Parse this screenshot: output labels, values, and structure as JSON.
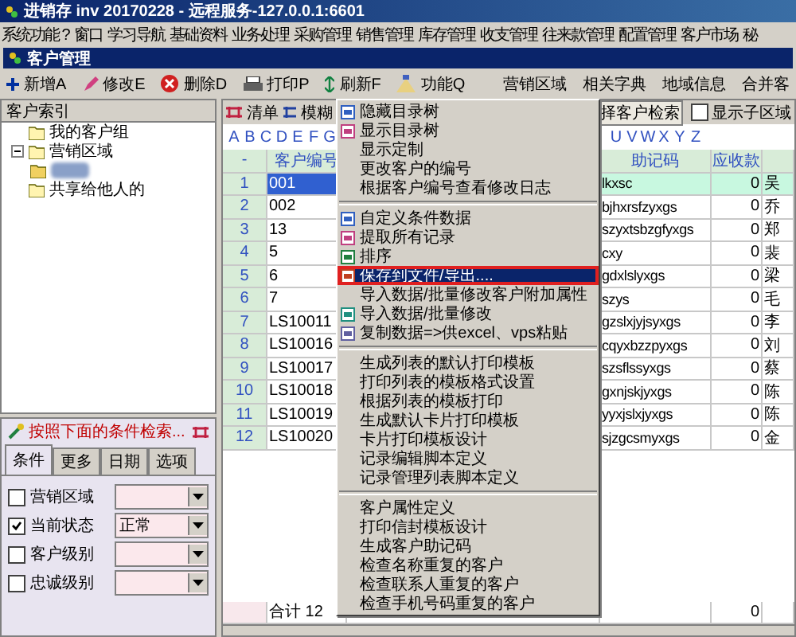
{
  "title": "进销存 inv 20170228 - 远程服务-127.0.0.1:6601",
  "menubar": [
    "系统功能 ?",
    "窗口",
    "学习导航",
    "基础资料",
    "业务处理",
    "采购管理",
    "销售管理",
    "库存管理",
    "收支管理",
    "往来款管理",
    "配置管理",
    "客户市场",
    "秘"
  ],
  "window_title": "客户管理",
  "toolbar": [
    {
      "label": "新增A",
      "kind": "add"
    },
    {
      "label": "修改E",
      "kind": "edit"
    },
    {
      "label": "删除D",
      "kind": "delete"
    },
    {
      "label": "打印P",
      "kind": "print"
    },
    {
      "label": "刷新F",
      "kind": "refresh"
    },
    {
      "label": "功能Q",
      "kind": "function"
    }
  ],
  "toolbar_links": [
    "营销区域",
    "相关字典",
    "地域信息",
    "合并客"
  ],
  "index_panel": {
    "title": "客户索引",
    "tree": [
      {
        "label": "我的客户组",
        "expanded": false
      },
      {
        "label": "营销区域",
        "expanded": true,
        "children": [
          {
            "kind": "blurred"
          }
        ]
      },
      {
        "label": "共享给他人的",
        "expanded": false
      }
    ]
  },
  "search_panel": {
    "title": "按照下面的条件检索...",
    "tabs": [
      {
        "label": "条件",
        "selected": true
      },
      {
        "label": "更多",
        "selected": false
      },
      {
        "label": "日期",
        "selected": false
      },
      {
        "label": "选项",
        "selected": false
      }
    ],
    "conditions": [
      {
        "label": "营销区域",
        "checked": false
      },
      {
        "label": "当前状态",
        "checked": true,
        "value": "正常"
      },
      {
        "label": "客户级别",
        "checked": false
      },
      {
        "label": "忠诚级别",
        "checked": false
      }
    ]
  },
  "grid": {
    "toolbar": [
      "清单",
      "模糊"
    ],
    "search_button": "择客户检索",
    "subregion_checkbox": {
      "label": "显示子区域",
      "checked": false
    },
    "letters_left": [
      "A",
      "B",
      "C",
      "D",
      "E",
      "F",
      "G"
    ],
    "letters_right": [
      "U",
      "V",
      "W",
      "X",
      "Y",
      "Z"
    ],
    "columns": [
      "-",
      "客户编号",
      "助记码",
      "应收款"
    ],
    "rows": [
      {
        "no": "1",
        "code": "001",
        "mnemonic": "lkxsc",
        "receivable": "0",
        "column_5": "吴",
        "selected": true
      },
      {
        "no": "2",
        "code": "002",
        "mnemonic": "bjhxrsfzyxgs",
        "receivable": "0",
        "column_5": "乔",
        "selected": false
      },
      {
        "no": "3",
        "code": "13",
        "mnemonic": "szyxtsbzgfyxgs",
        "receivable": "0",
        "column_5": "郑",
        "selected": false
      },
      {
        "no": "4",
        "code": "5",
        "mnemonic": "cxy",
        "receivable": "0",
        "column_5": "裴",
        "selected": false
      },
      {
        "no": "5",
        "code": "6",
        "mnemonic": "gdxlslyxgs",
        "receivable": "0",
        "column_5": "梁",
        "selected": false
      },
      {
        "no": "6",
        "code": "7",
        "mnemonic": "szys",
        "receivable": "0",
        "column_5": "毛",
        "selected": false
      },
      {
        "no": "7",
        "code": "LS10011",
        "mnemonic": "gzslxjyjsyxgs",
        "receivable": "0",
        "column_5": "李",
        "selected": false
      },
      {
        "no": "8",
        "code": "LS10016",
        "mnemonic": "cqyxbzzpyxgs",
        "receivable": "0",
        "column_5": "刘",
        "selected": false
      },
      {
        "no": "9",
        "code": "LS10017",
        "mnemonic": "szsflssyxgs",
        "receivable": "0",
        "column_5": "蔡",
        "selected": false
      },
      {
        "no": "10",
        "code": "LS10018",
        "mnemonic": "gxnjskjyxgs",
        "receivable": "0",
        "column_5": "陈",
        "selected": false
      },
      {
        "no": "11",
        "code": "LS10019",
        "mnemonic": "yyxjslxjyxgs",
        "receivable": "0",
        "column_5": "陈",
        "selected": false
      },
      {
        "no": "12",
        "code": "LS10020",
        "mnemonic": "sjzgcsmyxgs",
        "receivable": "0",
        "column_5": "金",
        "selected": false
      }
    ],
    "total": {
      "label": "合计 12",
      "receivable": "0"
    }
  },
  "context_menu": [
    [
      {
        "label": "隐藏目录树",
        "kind": "icon",
        "selected": false
      },
      {
        "label": "显示目录树",
        "kind": "icon",
        "selected": false
      },
      {
        "label": "显示定制",
        "kind": "text",
        "selected": false
      },
      {
        "label": "更改客户的编号",
        "kind": "text",
        "selected": false
      },
      {
        "label": "根据客户编号查看修改日志",
        "kind": "text",
        "selected": false
      }
    ],
    [
      {
        "label": "自定义条件数据",
        "kind": "icon",
        "selected": false
      },
      {
        "label": "提取所有记录",
        "kind": "icon",
        "selected": false
      },
      {
        "label": "排序",
        "kind": "icon",
        "selected": false
      },
      {
        "label": "保存到文件/导出....",
        "kind": "icon",
        "selected": true
      },
      {
        "label": "导入数据/批量修改客户附加属性",
        "kind": "text",
        "selected": false
      },
      {
        "label": "导入数据/批量修改",
        "kind": "icon",
        "selected": false
      },
      {
        "label": "复制数据=>供excel、vps粘贴",
        "kind": "icon",
        "selected": false
      }
    ],
    [
      {
        "label": "生成列表的默认打印模板",
        "kind": "text",
        "selected": false
      },
      {
        "label": "打印列表的模板格式设置",
        "kind": "text",
        "selected": false
      },
      {
        "label": "根据列表的模板打印",
        "kind": "text",
        "selected": false
      },
      {
        "label": "生成默认卡片打印模板",
        "kind": "text",
        "selected": false
      },
      {
        "label": "卡片打印模板设计",
        "kind": "text",
        "selected": false
      },
      {
        "label": "记录编辑脚本定义",
        "kind": "text",
        "selected": false
      },
      {
        "label": "记录管理列表脚本定义",
        "kind": "text",
        "selected": false
      }
    ],
    [
      {
        "label": "客户属性定义",
        "kind": "text",
        "selected": false
      },
      {
        "label": "打印信封模板设计",
        "kind": "text",
        "selected": false
      },
      {
        "label": "生成客户助记码",
        "kind": "text",
        "selected": false
      },
      {
        "label": "检查名称重复的客户",
        "kind": "text",
        "selected": false
      },
      {
        "label": "检查联系人重复的客户",
        "kind": "text",
        "selected": false
      },
      {
        "label": "检查手机号码重复的客户",
        "kind": "text",
        "selected": false
      }
    ]
  ]
}
